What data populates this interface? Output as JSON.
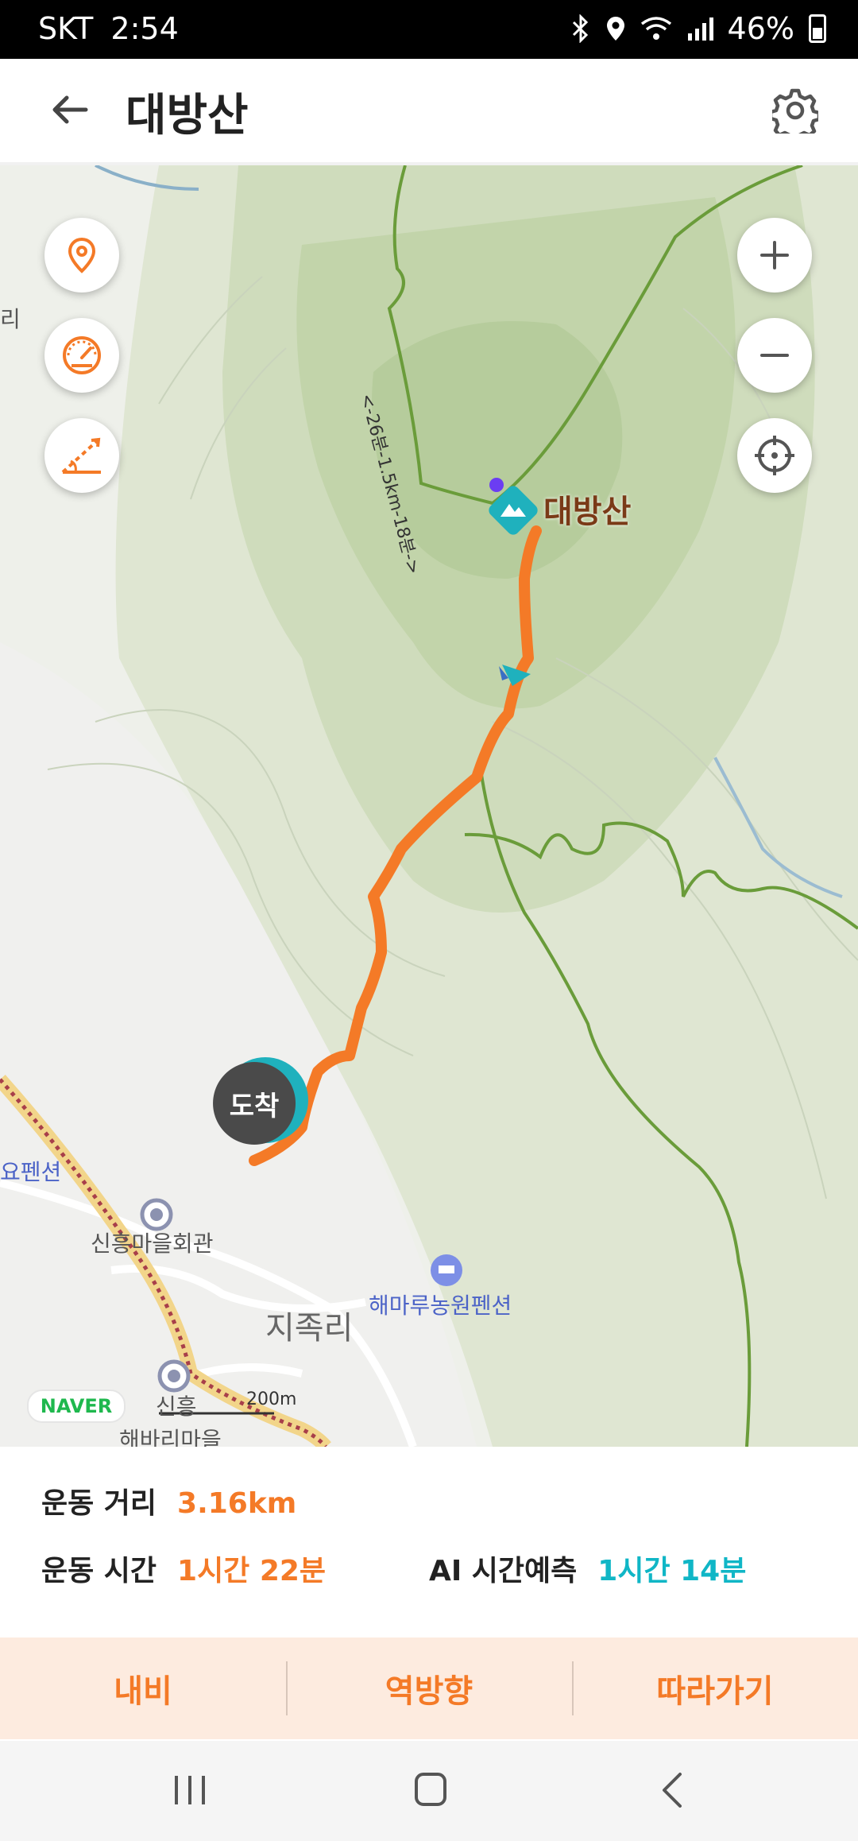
{
  "status_bar": {
    "carrier": "SKT",
    "time": "2:54",
    "battery": "46%",
    "icons": [
      "bluetooth-icon",
      "location-icon",
      "wifi-icon",
      "signal-icon",
      "battery-icon"
    ]
  },
  "header": {
    "title": "대방산",
    "back_icon": "arrow-left-icon",
    "settings_icon": "gear-icon"
  },
  "map": {
    "summit_label": "대방산",
    "trail_distance_label": "<-26분-1.5km-18분->",
    "arrival_marker": "도착",
    "places": {
      "village": "지족리",
      "hall": "신흥마을회관",
      "pension1": "해마루농원펜션",
      "pension2": "요펜션",
      "area1": "신흥",
      "area2": "해바리마을",
      "edge": "리"
    },
    "scale": "200m",
    "provider": "NAVER",
    "left_buttons": [
      "marker-icon",
      "speedometer-icon",
      "slope-icon"
    ],
    "right_buttons": [
      "zoom-in-icon",
      "zoom-out-icon",
      "locate-icon"
    ],
    "colors": {
      "route": "#f47a27",
      "trail": "#6a9c3a",
      "accent_teal": "#1fb1bd"
    }
  },
  "stats": {
    "distance_label": "운동 거리",
    "distance_value": "3.16km",
    "time_label": "운동 시간",
    "time_value": "1시간 22분",
    "ai_label": "AI 시간예측",
    "ai_value": "1시간 14분"
  },
  "actions": {
    "navi": "내비",
    "reverse": "역방향",
    "follow": "따라가기"
  },
  "nav_bar": [
    "recent-apps-icon",
    "home-icon",
    "back-icon"
  ]
}
